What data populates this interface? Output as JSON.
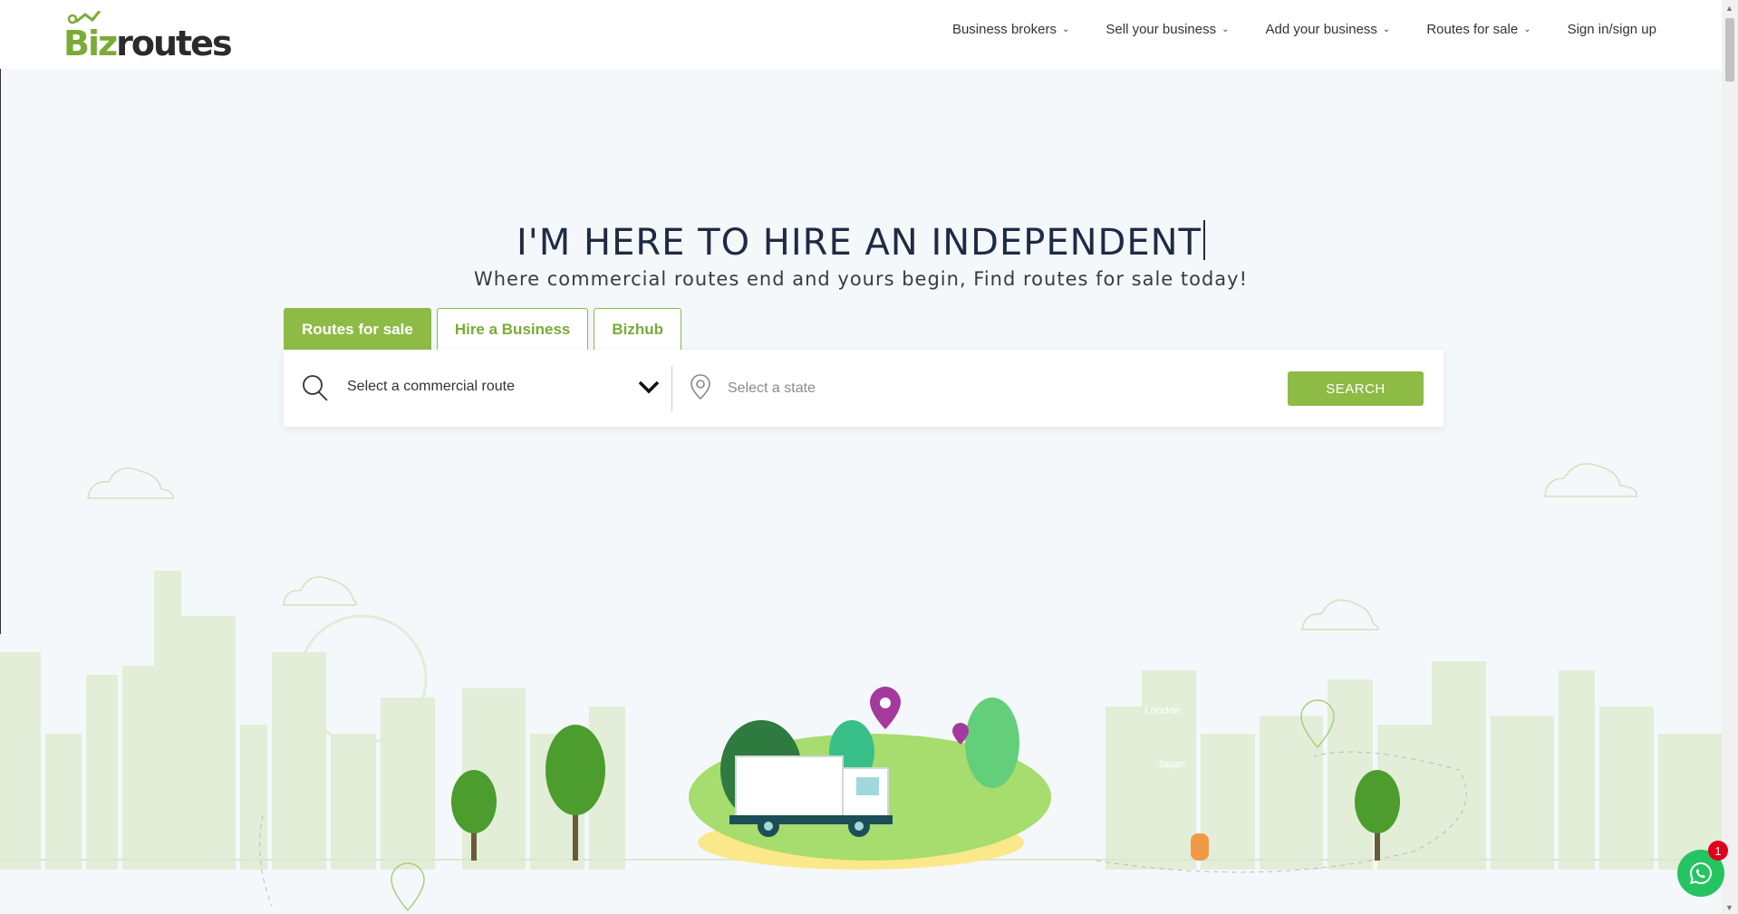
{
  "brand": {
    "name_part1": "Biz",
    "name_part2": "routes",
    "accent_color": "#7aab36"
  },
  "nav": {
    "items": [
      {
        "label": "Business brokers",
        "has_dropdown": true
      },
      {
        "label": "Sell your business",
        "has_dropdown": true
      },
      {
        "label": "Add your business",
        "has_dropdown": true
      },
      {
        "label": "Routes for sale",
        "has_dropdown": true
      },
      {
        "label": "Sign in/sign up",
        "has_dropdown": false
      }
    ]
  },
  "hero": {
    "title": "I'M HERE TO HIRE AN INDEPENDENT",
    "subtitle": "Where commercial routes end and yours begin, Find routes for sale today!"
  },
  "tabs": [
    {
      "label": "Routes for sale",
      "active": true
    },
    {
      "label": "Hire a Business",
      "active": false
    },
    {
      "label": "Bizhub",
      "active": false
    }
  ],
  "search": {
    "route_select_label": "Select a commercial route",
    "state_placeholder": "Select a state",
    "button_label": "SEARCH"
  },
  "illustration": {
    "city_labels": [
      "London",
      "Japan"
    ]
  },
  "whatsapp": {
    "badge_count": "1",
    "color": "#25c460"
  },
  "colors": {
    "primary_green": "#8dbb46",
    "title_navy": "#1f2a44",
    "background": "#f4f8fb"
  }
}
